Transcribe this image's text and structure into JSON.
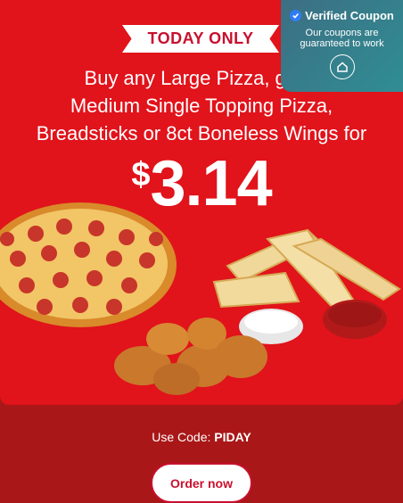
{
  "promo": {
    "banner": "TODAY ONLY",
    "headline": [
      "Buy any Large Pizza, get a",
      "Medium Single Topping Pizza,",
      "Breadsticks or 8ct Boneless Wings for"
    ],
    "price_currency": "$",
    "price_value": "3.14"
  },
  "verified": {
    "title": "Verified Coupon",
    "subtitle": "Our coupons are guaranteed to work",
    "icon": "home-icon"
  },
  "coupon": {
    "code_label": "Use Code:",
    "code_value": "PIDAY"
  },
  "cta": {
    "label": "Order now"
  },
  "colors": {
    "promo_red": "#e1131b",
    "page_dark_red": "#a91718",
    "accent_red": "#c8102e",
    "verified_teal": "#2f8e93"
  }
}
